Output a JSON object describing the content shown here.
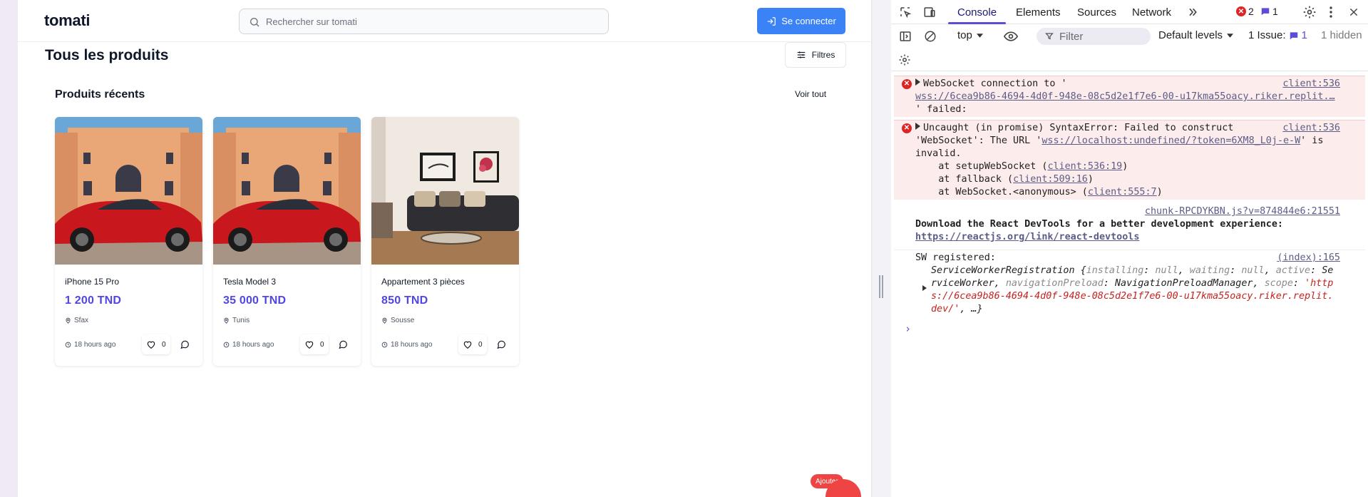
{
  "app": {
    "logo": "tomati",
    "search_placeholder": "Rechercher sur tomati",
    "login_label": "Se connecter",
    "page_title": "Tous les produits",
    "filters_label": "Filtres",
    "section_title": "Produits récents",
    "see_all_label": "Voir tout",
    "add_label": "Ajouter",
    "accent_color": "#3b82f6",
    "price_color": "#4f46e5",
    "products": [
      {
        "name": "iPhone 15 Pro",
        "price": "1 200 TND",
        "location": "Sfax",
        "time": "18 hours ago",
        "likes": "0",
        "image": "red-car-villa"
      },
      {
        "name": "Tesla Model 3",
        "price": "35 000 TND",
        "location": "Tunis",
        "time": "18 hours ago",
        "likes": "0",
        "image": "red-car-villa"
      },
      {
        "name": "Appartement 3 pièces",
        "price": "850 TND",
        "location": "Sousse",
        "time": "18 hours ago",
        "likes": "0",
        "image": "living-room"
      }
    ]
  },
  "devtools": {
    "tabs": [
      "Console",
      "Elements",
      "Sources",
      "Network"
    ],
    "active_tab": "Console",
    "error_count": "2",
    "message_count": "1",
    "context": "top",
    "filter_placeholder": "Filter",
    "levels_label": "Default levels",
    "issues_label": "1 Issue:",
    "issues_count": "1",
    "hidden_label": "1 hidden",
    "logs": {
      "ws_error": {
        "source": "client:536",
        "line1": "WebSocket connection to '",
        "url": "wss://6cea9b86-4694-4d0f-948e-08c5d2e1f7e6-00-u17kma55oacy.riker.replit.…",
        "line3": "' failed:"
      },
      "syntax_error": {
        "source": "client:536",
        "line1": "Uncaught (in promise) SyntaxError: Failed to construct",
        "line2_pre": "'WebSocket': The URL '",
        "line2_url": "wss://localhost:undefined/?token=6XM8_L0j-e-W",
        "line2_post": "' is",
        "line3": "invalid.",
        "stack1_pre": "    at setupWebSocket (",
        "stack1_link": "client:536:19",
        "stack2_pre": "    at fallback (",
        "stack2_link": "client:509:16",
        "stack3_pre": "    at WebSocket.<anonymous> (",
        "stack3_link": "client:555:7",
        "close": ")"
      },
      "react": {
        "source": "chunk-RPCDYKBN.js?v=874844e6:21551",
        "line1": "Download the React DevTools for a better development experience:",
        "link": "https://reactjs.org/link/react-devtools"
      },
      "sw": {
        "source": "(index):165",
        "line1": "SW registered:",
        "line2a": "ServiceWorkerRegistration {",
        "line2b": "installing",
        "line2c": ": ",
        "line2d": "null",
        "line2e": ", ",
        "line2f": "waiting",
        "line2g": ": ",
        "line2h": "null",
        "line2i": ", ",
        "line2j": "active",
        "line2k": ": Se",
        "line3a": "rviceWorker, ",
        "line3b": "navigationPreload",
        "line3c": ": NavigationPreloadManager, ",
        "line3d": "scope",
        "line3e": ": ",
        "line3f": "'http",
        "line4": "s://6cea9b86-4694-4d0f-948e-08c5d2e1f7e6-00-u17kma55oacy.riker.replit.",
        "line5a": "dev/'",
        "line5b": ", …}"
      }
    }
  }
}
